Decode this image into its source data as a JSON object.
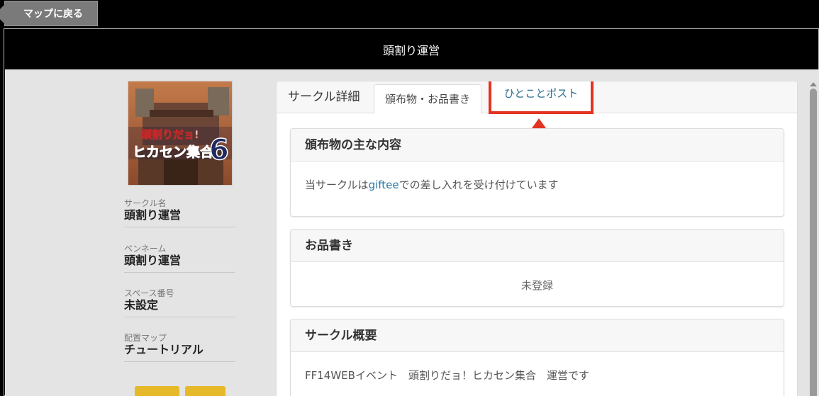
{
  "nav": {
    "back_label": "マップに戻る"
  },
  "header": {
    "title": "頭割り運営"
  },
  "sidebar": {
    "image_text_line1": "頭割りだョ!",
    "image_text_line2": "ヒカセン集合",
    "image_number": "6",
    "fields": [
      {
        "label": "サークル名",
        "value": "頭割り運営"
      },
      {
        "label": "ペンネーム",
        "value": "頭割り運営"
      },
      {
        "label": "スペース番号",
        "value": "未設定"
      },
      {
        "label": "配置マップ",
        "value": "チュートリアル"
      }
    ]
  },
  "tabs": {
    "title": "サークル詳細",
    "active": "頒布物・お品書き",
    "post": "ひとことポスト"
  },
  "cards": {
    "items_title": "頒布物の主な内容",
    "items_body_pre": "当サークルは",
    "items_body_link": "giftee",
    "items_body_post": "での差し入れを受け付けています",
    "menu_title": "お品書き",
    "menu_body": "未登録",
    "overview_title": "サークル概要",
    "overview_body": "FF14WEBイベント　頭割りだョ！ヒカセン集合　運営です"
  },
  "colors": {
    "accent": "#e33322",
    "link": "#2d6f8e",
    "button": "#e6b92a"
  }
}
